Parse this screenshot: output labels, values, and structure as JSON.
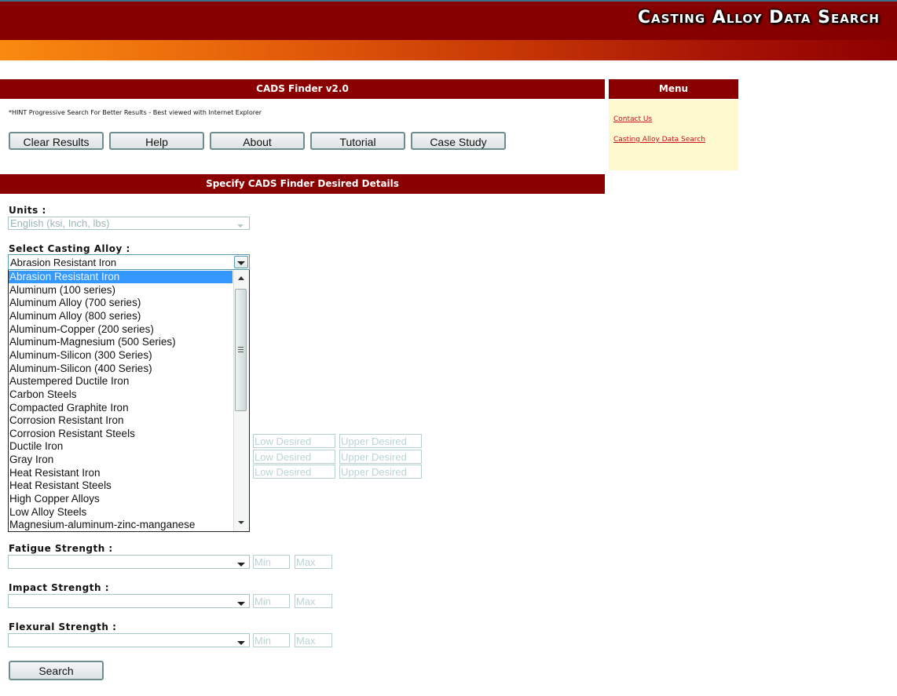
{
  "banner": {
    "title": "Casting Alloy Data Search"
  },
  "finder": {
    "title": "CADS Finder v2.0",
    "hint": "*HINT Progressive Search For Better Results - Best viewed with Internet Explorer",
    "buttons": [
      "Clear Results",
      "Help",
      "About",
      "Tutorial",
      "Case Study"
    ]
  },
  "menu": {
    "title": "Menu",
    "links": [
      "Contact Us",
      "Casting Alloy Data Search"
    ]
  },
  "details": {
    "title": "Specify CADS Finder Desired Details",
    "units_label": "Units :",
    "units_value": "English (ksi, Inch, lbs)",
    "alloy_label": "Select Casting Alloy :",
    "alloy_value": "Abrasion Resistant Iron",
    "alloy_options": [
      "Abrasion Resistant Iron",
      "Aluminum (100 series)",
      "Aluminum Alloy (700 series)",
      "Aluminum Alloy (800 series)",
      "Aluminum-Copper (200 series)",
      "Aluminum-Magnesium (500 Series)",
      "Aluminum-Silicon (300 Series)",
      "Aluminum-Silicon (400 Series)",
      "Austempered Ductile Iron",
      "Carbon Steels",
      "Compacted Graphite Iron",
      "Corrosion Resistant Iron",
      "Corrosion Resistant Steels",
      "Ductile Iron",
      "Gray Iron",
      "Heat Resistant Iron",
      "Heat Resistant Steels",
      "High Copper Alloys",
      "Low Alloy Steels",
      "Magnesium-aluminum-zinc-manganese"
    ],
    "range_rows": [
      {
        "low_placeholder": "Low Desired",
        "upper_placeholder": "Upper Desired"
      },
      {
        "low_placeholder": "Low Desired",
        "upper_placeholder": "Upper Desired"
      },
      {
        "low_placeholder": "Low Desired",
        "upper_placeholder": "Upper Desired"
      }
    ],
    "strength_fields": [
      {
        "label": "Fatigue Strength :",
        "value": "",
        "min_placeholder": "Min",
        "max_placeholder": "Max"
      },
      {
        "label": "Impact Strength :",
        "value": "",
        "min_placeholder": "Min",
        "max_placeholder": "Max"
      },
      {
        "label": "Flexural Strength :",
        "value": "",
        "min_placeholder": "Min",
        "max_placeholder": "Max"
      }
    ],
    "search_label": "Search"
  },
  "colors": {
    "brand_red": "#8a0000",
    "menu_bg": "#fff9d0",
    "link_red": "#d0101a",
    "selection_blue": "#3399ff"
  }
}
